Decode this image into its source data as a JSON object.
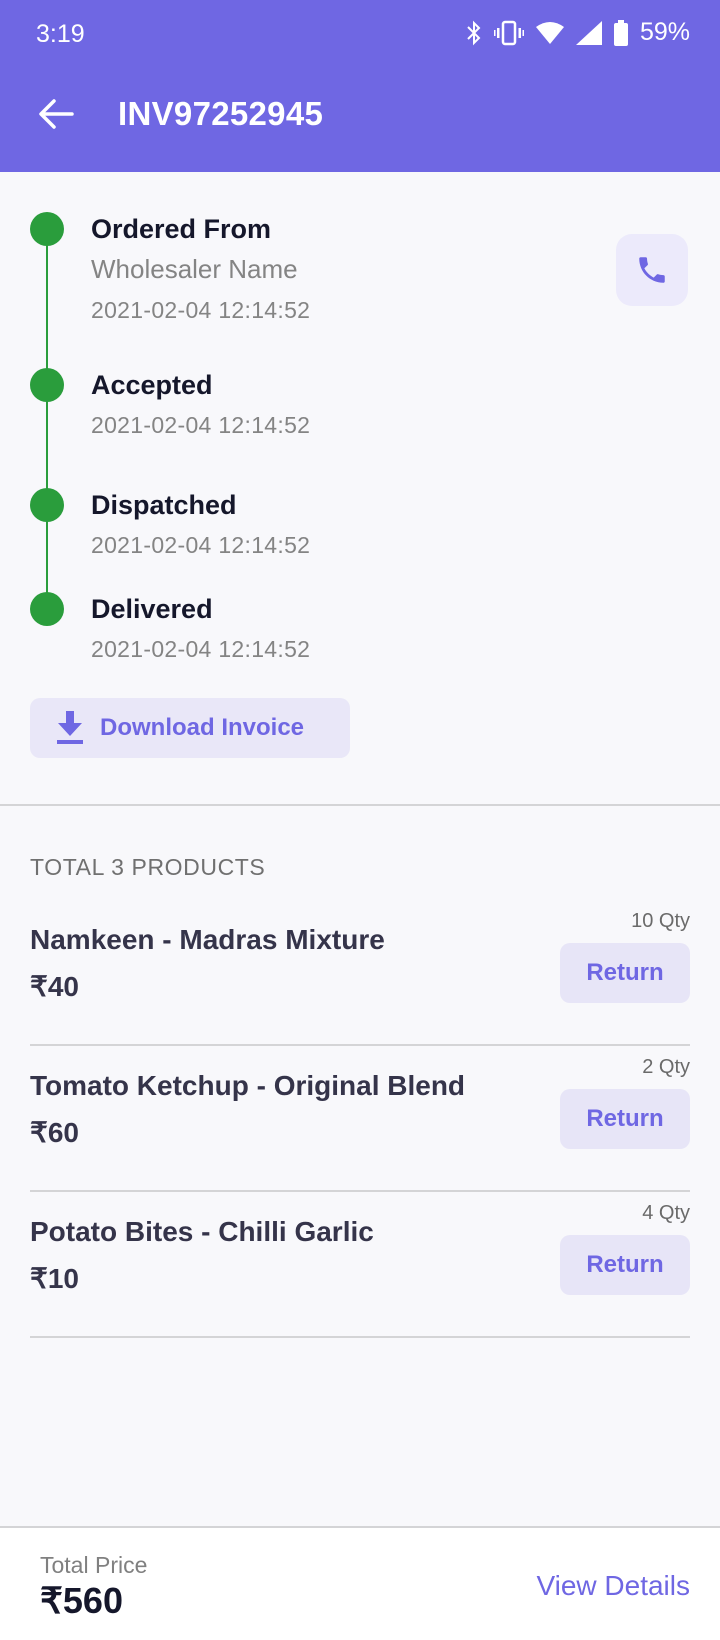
{
  "status_bar": {
    "time": "3:19",
    "battery": "59%",
    "icons": [
      "bluetooth-icon",
      "vibrate-icon",
      "wifi-icon",
      "signal-icon",
      "battery-icon"
    ]
  },
  "header": {
    "back_icon": "arrow-left-icon",
    "title": "INV97252945"
  },
  "timeline": {
    "color": "#2a9d3c",
    "steps": [
      {
        "title": "Ordered From",
        "subtitle": "Wholesaler Name",
        "time": "2021-02-04 12:14:52"
      },
      {
        "title": "Accepted",
        "time": "2021-02-04 12:14:52"
      },
      {
        "title": "Dispatched",
        "time": "2021-02-04 12:14:52"
      },
      {
        "title": "Delivered",
        "time": "2021-02-04 12:14:52"
      }
    ],
    "call_icon": "phone-icon"
  },
  "download_invoice": {
    "label": "Download Invoice",
    "icon": "download-icon"
  },
  "products": {
    "section_label": "TOTAL 3 PRODUCTS",
    "items": [
      {
        "name": "Namkeen - Madras Mixture",
        "price": "₹40",
        "qty": "10 Qty",
        "action": "Return"
      },
      {
        "name": "Tomato Ketchup - Original Blend",
        "price": "₹60",
        "qty": "2 Qty",
        "action": "Return"
      },
      {
        "name": "Potato Bites - Chilli Garlic",
        "price": "₹10",
        "qty": "4 Qty",
        "action": "Return"
      }
    ]
  },
  "footer": {
    "total_label": "Total Price",
    "total_value": "₹560",
    "view_details": "View Details"
  },
  "colors": {
    "accent": "#6f67e3",
    "success": "#2a9d3c",
    "background": "#f8f8fb"
  }
}
